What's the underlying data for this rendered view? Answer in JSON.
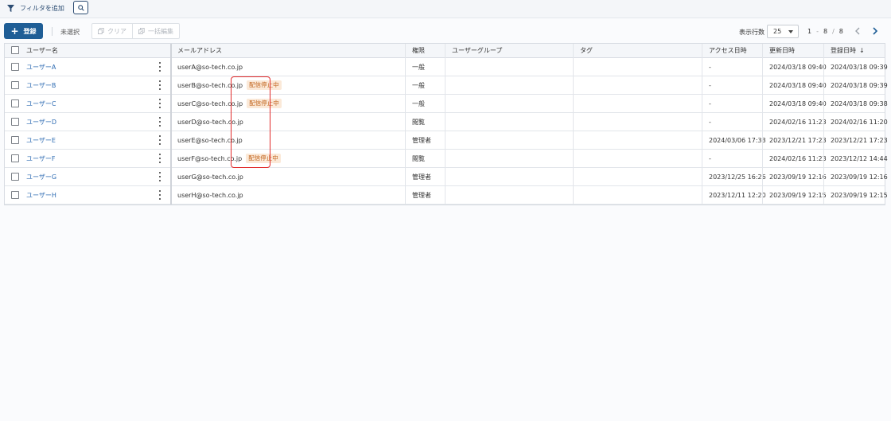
{
  "filterbar": {
    "add_filter_label": "フィルタを追加"
  },
  "toolbar": {
    "register_label": "登録",
    "unselected_label": "未選択",
    "clear_label": "クリア",
    "bulk_edit_label": "一括編集"
  },
  "pagination": {
    "rows_label": "表示行数",
    "rows_value": "25",
    "range_start": "1",
    "range_dash": "-",
    "range_end": "8",
    "slash": "/",
    "total": "8"
  },
  "table": {
    "headers": {
      "username": "ユーザー名",
      "email": "メールアドレス",
      "role": "権限",
      "user_group": "ユーザーグループ",
      "tag": "タグ",
      "access_datetime": "アクセス日時",
      "updated_datetime": "更新日時",
      "registered_datetime": "登録日時",
      "sort_indicator": "↓"
    },
    "rows": [
      {
        "name": "ユーザーA",
        "email": "userA@so-tech.co.jp",
        "badge": "",
        "role": "一般",
        "group": "",
        "tag": "",
        "access": "-",
        "updated": "2024/03/18 09:40",
        "registered": "2024/03/18 09:39"
      },
      {
        "name": "ユーザーB",
        "email": "userB@so-tech.co.jp",
        "badge": "配信停止中",
        "role": "一般",
        "group": "",
        "tag": "",
        "access": "-",
        "updated": "2024/03/18 09:40",
        "registered": "2024/03/18 09:39"
      },
      {
        "name": "ユーザーC",
        "email": "userC@so-tech.co.jp",
        "badge": "配信停止中",
        "role": "一般",
        "group": "",
        "tag": "",
        "access": "-",
        "updated": "2024/03/18 09:40",
        "registered": "2024/03/18 09:38"
      },
      {
        "name": "ユーザーD",
        "email": "userD@so-tech.co.jp",
        "badge": "",
        "role": "閲覧",
        "group": "",
        "tag": "",
        "access": "-",
        "updated": "2024/02/16 11:23",
        "registered": "2024/02/16 11:20"
      },
      {
        "name": "ユーザーE",
        "email": "userE@so-tech.co.jp",
        "badge": "",
        "role": "管理者",
        "group": "",
        "tag": "",
        "access": "2024/03/06 17:33",
        "updated": "2023/12/21 17:23",
        "registered": "2023/12/21 17:23"
      },
      {
        "name": "ユーザーF",
        "email": "userF@so-tech.co.jp",
        "badge": "配信停止中",
        "role": "閲覧",
        "group": "",
        "tag": "",
        "access": "-",
        "updated": "2024/02/16 11:23",
        "registered": "2023/12/12 14:44"
      },
      {
        "name": "ユーザーG",
        "email": "userG@so-tech.co.jp",
        "badge": "",
        "role": "管理者",
        "group": "",
        "tag": "",
        "access": "2023/12/25 16:26",
        "updated": "2023/09/19 12:16",
        "registered": "2023/09/19 12:16"
      },
      {
        "name": "ユーザーH",
        "email": "userH@so-tech.co.jp",
        "badge": "",
        "role": "管理者",
        "group": "",
        "tag": "",
        "access": "2023/12/11 12:20",
        "updated": "2023/09/19 12:15",
        "registered": "2023/09/19 12:15"
      }
    ]
  },
  "colors": {
    "primary": "#1f5e96",
    "link": "#2f6cb3",
    "badge_bg": "#fbe9d8",
    "badge_text": "#c0621a",
    "highlight": "#e12a2a"
  }
}
